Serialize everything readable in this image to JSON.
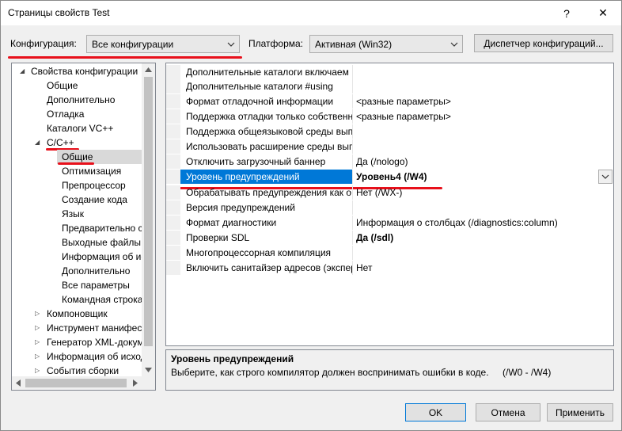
{
  "window": {
    "title": "Страницы свойств Test",
    "help": "?",
    "close": "✕"
  },
  "config": {
    "label": "Конфигурация:",
    "value": "Все конфигурации"
  },
  "platform": {
    "label": "Платформа:",
    "value": "Активная (Win32)"
  },
  "config_manager_label": "Диспетчер конфигураций...",
  "tree": [
    {
      "label": "Свойства конфигурации",
      "expander": "◢"
    },
    {
      "label": "Общие"
    },
    {
      "label": "Дополнительно"
    },
    {
      "label": "Отладка"
    },
    {
      "label": "Каталоги VC++"
    },
    {
      "label": "C/C++",
      "expander": "◢"
    },
    {
      "label": "Общие"
    },
    {
      "label": "Оптимизация"
    },
    {
      "label": "Препроцессор"
    },
    {
      "label": "Создание кода"
    },
    {
      "label": "Язык"
    },
    {
      "label": "Предварительно ск"
    },
    {
      "label": "Выходные файлы"
    },
    {
      "label": "Информация об ис"
    },
    {
      "label": "Дополнительно"
    },
    {
      "label": "Все параметры"
    },
    {
      "label": "Командная строка"
    },
    {
      "label": "Компоновщик",
      "expander": "▷"
    },
    {
      "label": "Инструмент манифест",
      "expander": "▷"
    },
    {
      "label": "Генератор XML-докум",
      "expander": "▷"
    },
    {
      "label": "Информация об исход",
      "expander": "▷"
    },
    {
      "label": "События сборки",
      "expander": "▷"
    }
  ],
  "properties": [
    {
      "name": "Дополнительные каталоги включаем",
      "value": ""
    },
    {
      "name": "Дополнительные каталоги #using",
      "value": ""
    },
    {
      "name": "Формат отладочной информации",
      "value": "<разные параметры>"
    },
    {
      "name": "Поддержка отладки только собственн",
      "value": "<разные параметры>"
    },
    {
      "name": "Поддержка общеязыковой среды вып",
      "value": ""
    },
    {
      "name": "Использовать расширение среды вып",
      "value": ""
    },
    {
      "name": "Отключить загрузочный баннер",
      "value": "Да (/nologo)"
    },
    {
      "name": "Уровень предупреждений",
      "value": "Уровень4 (/W4)"
    },
    {
      "name": "Обрабатывать предупреждения как о",
      "value": "Нет (/WX-)"
    },
    {
      "name": "Версия предупреждений",
      "value": ""
    },
    {
      "name": "Формат диагностики",
      "value": "Информация о столбцах (/diagnostics:column)"
    },
    {
      "name": "Проверки SDL",
      "value": "Да (/sdl)"
    },
    {
      "name": "Многопроцессорная компиляция",
      "value": ""
    },
    {
      "name": "Включить санитайзер адресов (экспер",
      "value": "Нет"
    }
  ],
  "description": {
    "title": "Уровень предупреждений",
    "text": "Выберите, как строго компилятор должен воспринимать ошибки в коде.",
    "range": "(/W0 - /W4)"
  },
  "buttons": {
    "ok": "OK",
    "cancel": "Отмена",
    "apply": "Применить"
  },
  "colors": {
    "selection": "#0078d7",
    "annotation": "#e8101b"
  }
}
